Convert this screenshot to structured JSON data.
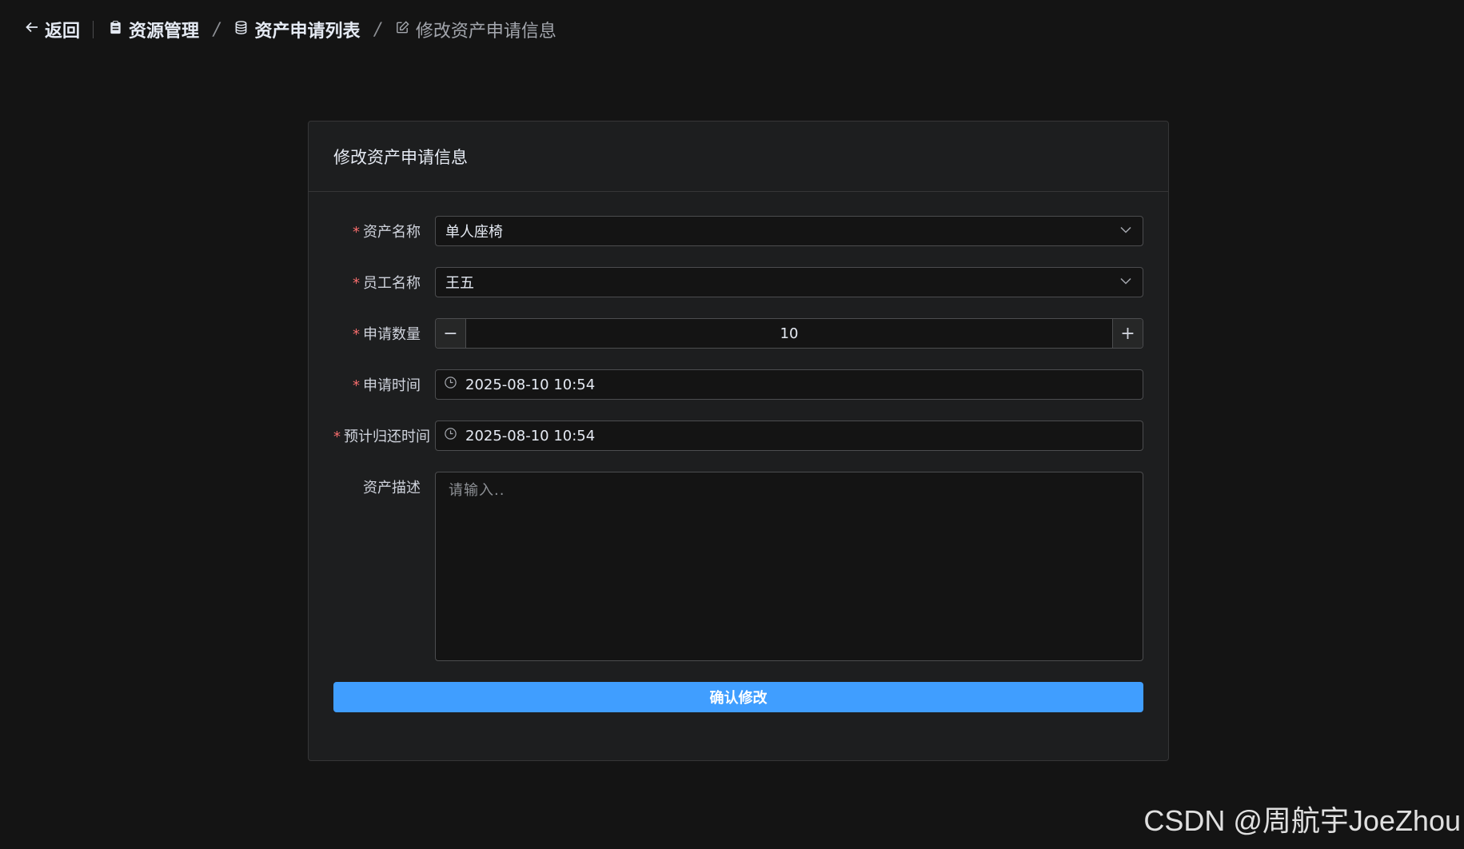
{
  "breadcrumb": {
    "back_label": "返回",
    "items": [
      {
        "label": "资源管理",
        "icon": "clipboard-icon"
      },
      {
        "label": "资产申请列表",
        "icon": "database-icon"
      },
      {
        "label": "修改资产申请信息",
        "icon": "edit-icon"
      }
    ],
    "separator": "/"
  },
  "card": {
    "title": "修改资产申请信息"
  },
  "form": {
    "asset_name": {
      "label": "资产名称",
      "required_mark": "*",
      "value": "单人座椅"
    },
    "employee_name": {
      "label": "员工名称",
      "required_mark": "*",
      "value": "王五"
    },
    "quantity": {
      "label": "申请数量",
      "required_mark": "*",
      "value": "10",
      "minus": "−",
      "plus": "+"
    },
    "apply_time": {
      "label": "申请时间",
      "required_mark": "*",
      "value": "2025-08-10 10:54"
    },
    "return_time": {
      "label": "预计归还时间",
      "required_mark": "*",
      "value": "2025-08-10 10:54"
    },
    "description": {
      "label": "资产描述",
      "placeholder": "请输入.."
    },
    "submit_label": "确认修改"
  },
  "watermark": "CSDN @周航宇JoeZhou",
  "colors": {
    "primary": "#409eff",
    "required": "#f56c6c",
    "background": "#141414",
    "card": "#1d1e1f"
  }
}
